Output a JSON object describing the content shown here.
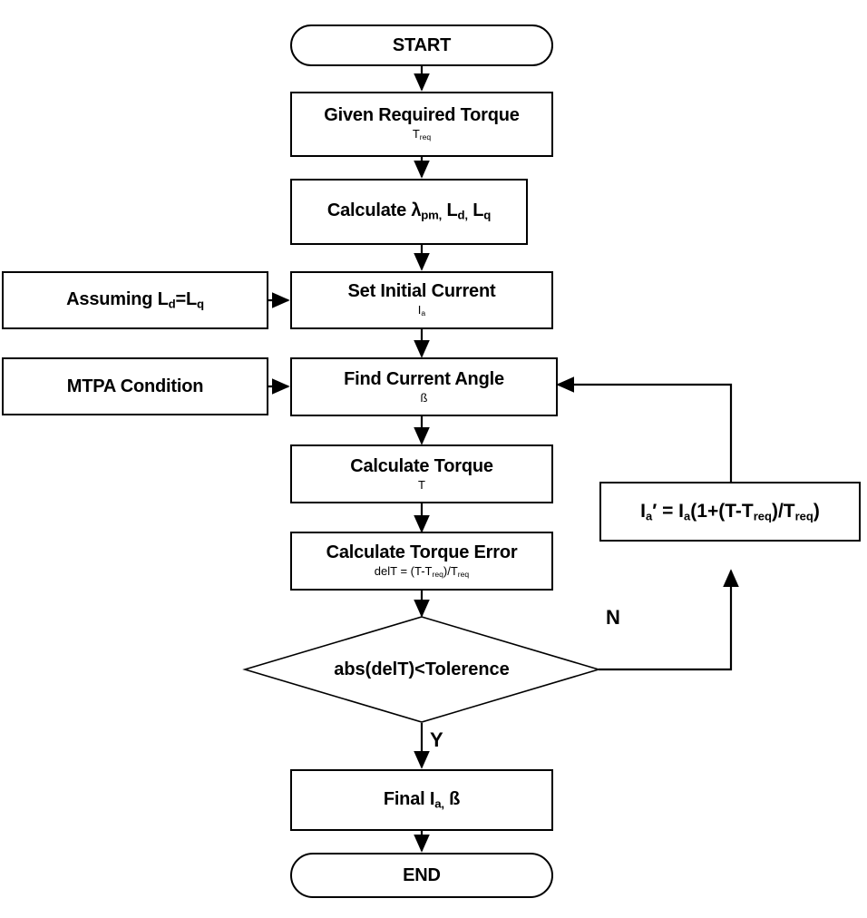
{
  "diagram": {
    "title": "MTPA current-angle iterative solver flowchart",
    "type": "flowchart",
    "background_color": "#ffffff",
    "line_color": "#000000",
    "text_color": "#000000"
  },
  "nodes": {
    "start": {
      "shape": "terminator",
      "label": "START"
    },
    "given_torque": {
      "shape": "process",
      "label": "Given Required Torque",
      "sub_prefix": "T",
      "sub_subscript": "req"
    },
    "calculate_params": {
      "shape": "process",
      "label_part1": "Calculate λ",
      "label_sub1": "pm,",
      "label_part2": " L",
      "label_sub2": "d,",
      "label_part3": " L",
      "label_sub3": "q"
    },
    "set_initial_current": {
      "shape": "process",
      "label": "Set Initial Current",
      "sub_prefix": "I",
      "sub_subscript": "a"
    },
    "assuming": {
      "shape": "process",
      "label_part1": "Assuming L",
      "label_sub1": "d",
      "label_part2": "=L",
      "label_sub2": "q"
    },
    "mtpa_condition": {
      "shape": "process",
      "label": "MTPA Condition"
    },
    "find_current_angle": {
      "shape": "process",
      "label": "Find Current Angle",
      "sub": "ß"
    },
    "calculate_torque": {
      "shape": "process",
      "label": "Calculate Torque",
      "sub": "T"
    },
    "calculate_torque_error": {
      "shape": "process",
      "label": "Calculate Torque Error",
      "sub_p1": "delT = (T-T",
      "sub_s1": "req",
      "sub_p2": ")/T",
      "sub_s2": "req"
    },
    "decision": {
      "shape": "decision",
      "label": "abs(delT)<Tolerence"
    },
    "update_current": {
      "shape": "process",
      "f_p1": "I",
      "f_s1": "a",
      "f_p2": "′ = I",
      "f_s2": "a",
      "f_p3": "(1+(T-T",
      "f_s3": "req",
      "f_p4": ")/T",
      "f_s4": "req",
      "f_p5": ")"
    },
    "final": {
      "shape": "process",
      "label_part1": "Final I",
      "label_sub1": "a,",
      "label_part2": " ß"
    },
    "end": {
      "shape": "terminator",
      "label": "END"
    }
  },
  "edge_labels": {
    "no_branch": "N",
    "yes_branch": "Y"
  }
}
